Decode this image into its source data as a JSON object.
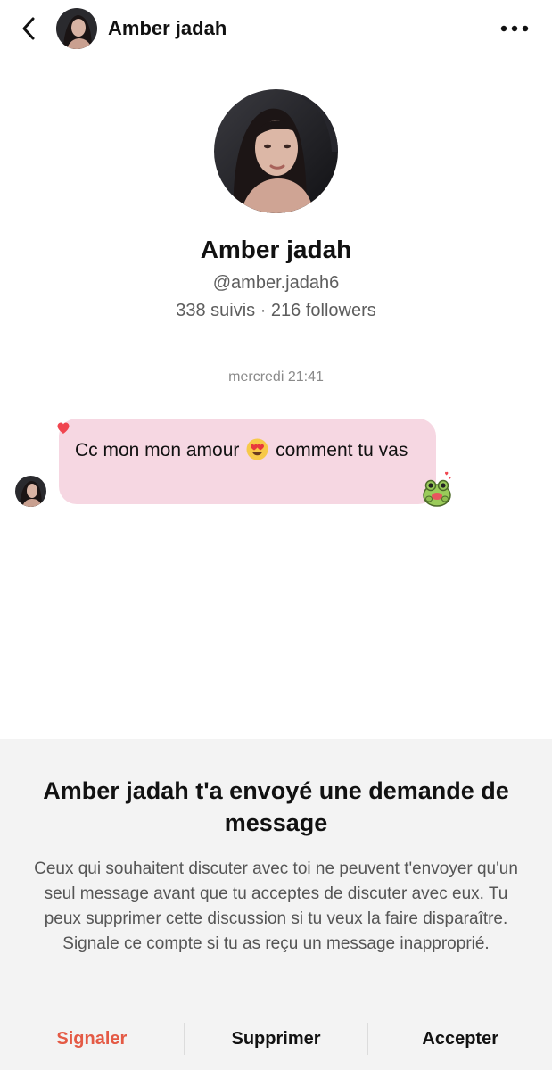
{
  "header": {
    "name": "Amber jadah"
  },
  "profile": {
    "name": "Amber jadah",
    "handle": "@amber.jadah6",
    "stats": "338 suivis · 216 followers"
  },
  "conversation": {
    "timestamp": "mercredi 21:41",
    "message": {
      "text_before": "Cc mon mon amour",
      "emoji": "heart-eyes-emoji",
      "text_after": "comment tu vas"
    }
  },
  "request_sheet": {
    "title": "Amber jadah t'a envoyé une demande de message",
    "body": "Ceux qui souhaitent discuter avec toi ne peuvent t'envoyer qu'un seul message avant que tu acceptes de discuter avec eux. Tu peux supprimer cette discussion si tu veux la faire disparaître. Signale ce compte si tu as reçu un message inapproprié.",
    "actions": {
      "report": "Signaler",
      "delete": "Supprimer",
      "accept": "Accepter"
    }
  },
  "colors": {
    "bubble": "#f6d7e2",
    "sheet_background": "#f3f3f3",
    "report_action": "#e45a45"
  },
  "icons": {
    "back": "chevron-left-icon",
    "more": "more-horizontal-icon",
    "reaction": "heart-icon",
    "sticker": "frog-sticker-icon"
  }
}
